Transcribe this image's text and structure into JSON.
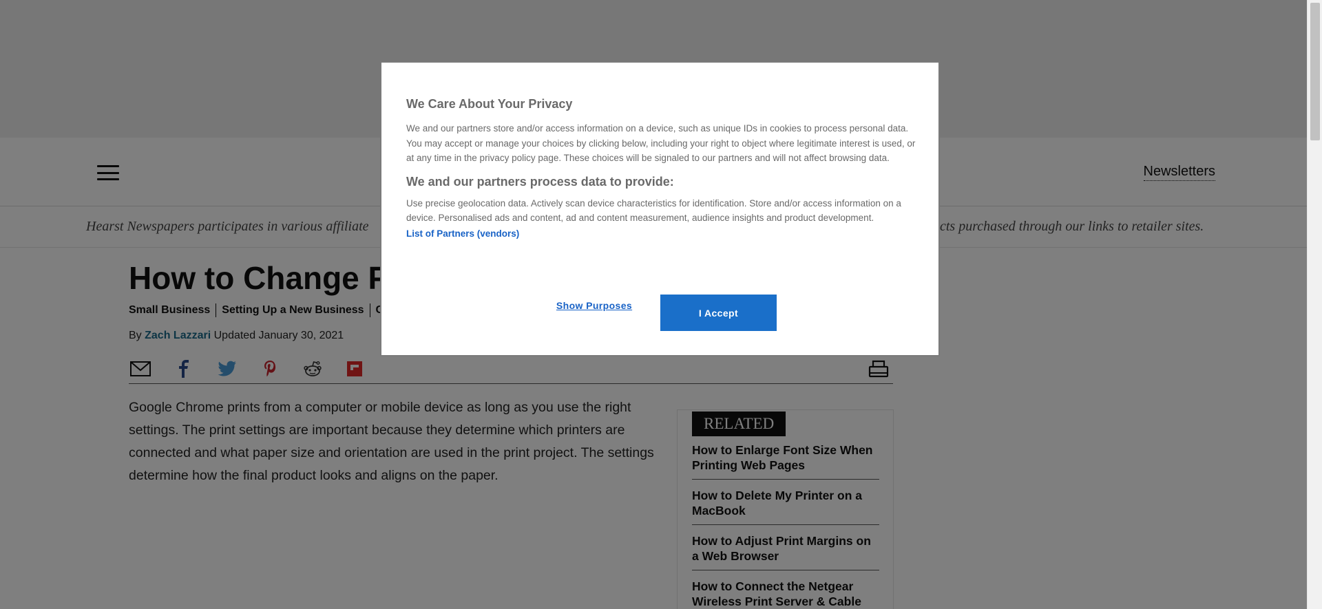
{
  "header": {
    "menu_icon": "hamburger-icon",
    "newsletters_label": "Newsletters"
  },
  "disclosure": {
    "left_text": "Hearst Newspapers participates in various affiliate",
    "right_text": "cts purchased through our links to retailer sites."
  },
  "article": {
    "title": "How to Change Pr",
    "breadcrumbs": [
      "Small Business",
      "Setting Up a New Business",
      "C"
    ],
    "byline_prefix": "By",
    "author": "Zach Lazzari",
    "updated": "Updated January 30, 2021",
    "share_icons": [
      "email-icon",
      "facebook-icon",
      "twitter-icon",
      "pinterest-icon",
      "reddit-icon",
      "flipboard-icon",
      "print-icon"
    ],
    "body": "Google Chrome prints from a computer or mobile device as long as you use the right settings. The print settings are important because they determine which printers are connected and what paper size and orientation are used in the print project. The settings determine how the final product looks and aligns on the paper."
  },
  "related": {
    "label": "RELATED",
    "items": [
      "How to Enlarge Font Size When Printing Web Pages",
      "How to Delete My Printer on a MacBook",
      "How to Adjust Print Margins on a Web Browser",
      "How to Connect the Netgear Wireless Print Server & Cable"
    ]
  },
  "consent": {
    "title": "We Care About Your Privacy",
    "intro": "We and our partners store and/or access information on a device, such as unique IDs in cookies to process personal data. You may accept or manage your choices by clicking below, including your right to object where legitimate interest is used, or at any time in the privacy policy page. These choices will be signaled to our partners and will not affect browsing data.",
    "subtitle": "We and our partners process data to provide:",
    "purposes": "Use precise geolocation data. Actively scan device characteristics for identification. Store and/or access information on a device. Personalised ads and content, ad and content measurement, audience insights and product development.",
    "partners_link": "List of Partners (vendors)",
    "show_purposes_label": "Show Purposes",
    "accept_label": "I Accept"
  },
  "colors": {
    "accept_button": "#1a6fc9",
    "link": "#1862c6",
    "author_link": "#1b6a8a",
    "flipboard": "#e12828"
  }
}
